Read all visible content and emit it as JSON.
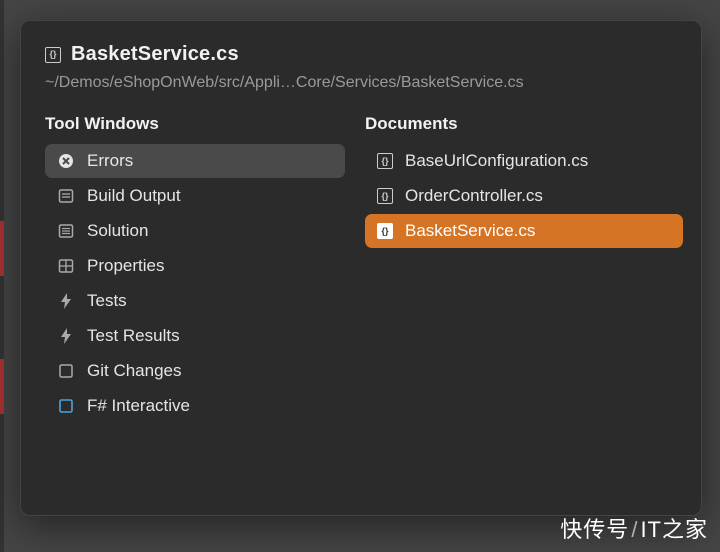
{
  "header": {
    "title": "BasketService.cs",
    "icon": "file-code-icon",
    "path": "~/Demos/eShopOnWeb/src/Appli…Core/Services/BasketService.cs"
  },
  "tool_windows": {
    "heading": "Tool Windows",
    "items": [
      {
        "icon": "error-icon",
        "label": "Errors",
        "selected": true
      },
      {
        "icon": "output-icon",
        "label": "Build Output",
        "selected": false
      },
      {
        "icon": "solution-icon",
        "label": "Solution",
        "selected": false
      },
      {
        "icon": "properties-icon",
        "label": "Properties",
        "selected": false
      },
      {
        "icon": "bolt-icon",
        "label": "Tests",
        "selected": false
      },
      {
        "icon": "bolt-icon",
        "label": "Test Results",
        "selected": false
      },
      {
        "icon": "git-icon",
        "label": "Git Changes",
        "selected": false
      },
      {
        "icon": "fsharp-icon",
        "label": "F# Interactive",
        "selected": false
      }
    ]
  },
  "documents": {
    "heading": "Documents",
    "items": [
      {
        "icon": "file-code-icon",
        "label": "BaseUrlConfiguration.cs",
        "selected": false
      },
      {
        "icon": "file-code-icon",
        "label": "OrderController.cs",
        "selected": false
      },
      {
        "icon": "file-code-icon",
        "label": "BasketService.cs",
        "selected": true
      }
    ]
  },
  "watermark": {
    "left": "快传号",
    "right": "IT之家"
  }
}
